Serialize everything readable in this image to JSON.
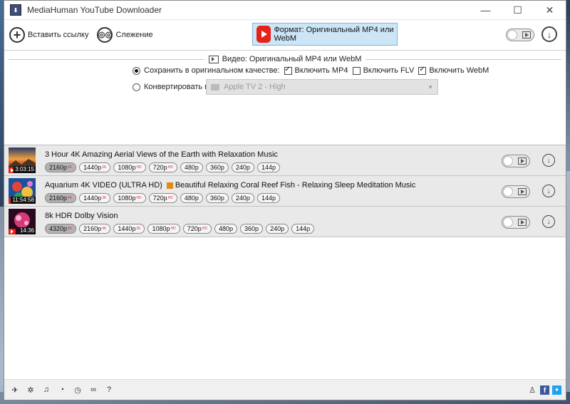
{
  "window": {
    "title": "MediaHuman YouTube Downloader",
    "app_icon": "app-logo-icon",
    "controls": [
      "minimize-icon",
      "maximize-icon",
      "close-icon"
    ]
  },
  "toolbar": {
    "paste_label": "Вставить ссылку",
    "tracking_label": "Слежение",
    "format_label": "Формат: Оригинальный MP4 или WebM"
  },
  "settings": {
    "section_title": "Видео: Оригинальный MP4 или WebM",
    "keep_original_label": "Сохранить в оригинальном качестве:",
    "include_mp4": "Включить MP4",
    "include_flv": "Включить FLV",
    "include_webm": "Включить WebM",
    "convert_label": "Конвертировать в:",
    "convert_target": "Apple TV 2 - High",
    "keep_original_selected": true,
    "mp4_checked": true,
    "flv_checked": false,
    "webm_checked": true
  },
  "videos": [
    {
      "title": "3 Hour 4K Amazing Aerial Views of the Earth with Relaxation Music",
      "duration": "3:03:15",
      "qualities": [
        {
          "label": "2160p",
          "badge": "4K",
          "selected": true
        },
        {
          "label": "1440p",
          "badge": "2K",
          "selected": false
        },
        {
          "label": "1080p",
          "badge": "HD",
          "selected": false
        },
        {
          "label": "720p",
          "badge": "HD",
          "selected": false
        },
        {
          "label": "480p",
          "badge": "",
          "selected": false
        },
        {
          "label": "360p",
          "badge": "",
          "selected": false
        },
        {
          "label": "240p",
          "badge": "",
          "selected": false
        },
        {
          "label": "144p",
          "badge": "",
          "selected": false
        }
      ]
    },
    {
      "title": "Aquarium 4K VIDEO (ULTRA HD)",
      "playlist": "Beautiful Relaxing Coral Reef Fish - Relaxing Sleep Meditation Music",
      "duration": "11:54:58",
      "qualities": [
        {
          "label": "2160p",
          "badge": "4K",
          "selected": true
        },
        {
          "label": "1440p",
          "badge": "2K",
          "selected": false
        },
        {
          "label": "1080p",
          "badge": "HD",
          "selected": false
        },
        {
          "label": "720p",
          "badge": "HD",
          "selected": false
        },
        {
          "label": "480p",
          "badge": "",
          "selected": false
        },
        {
          "label": "360p",
          "badge": "",
          "selected": false
        },
        {
          "label": "240p",
          "badge": "",
          "selected": false
        },
        {
          "label": "144p",
          "badge": "",
          "selected": false
        }
      ]
    },
    {
      "title": "8k HDR Dolby Vision",
      "duration": "14:36",
      "qualities": [
        {
          "label": "4320p",
          "badge": "8K",
          "selected": true
        },
        {
          "label": "2160p",
          "badge": "4K",
          "selected": false
        },
        {
          "label": "1440p",
          "badge": "2K",
          "selected": false
        },
        {
          "label": "1080p",
          "badge": "HD",
          "selected": false
        },
        {
          "label": "720p",
          "badge": "HD",
          "selected": false
        },
        {
          "label": "480p",
          "badge": "",
          "selected": false
        },
        {
          "label": "360p",
          "badge": "",
          "selected": false
        },
        {
          "label": "240p",
          "badge": "",
          "selected": false
        },
        {
          "label": "144p",
          "badge": "",
          "selected": false
        }
      ]
    }
  ],
  "statusbar": {
    "left_icons": [
      "telegram-icon",
      "settings-icon",
      "music-icon",
      "snail-icon",
      "clock-icon",
      "binoculars-icon",
      "help-icon"
    ],
    "help_glyph": "?",
    "right_icons": [
      "users-icon",
      "facebook-icon",
      "twitter-icon"
    ]
  },
  "colors": {
    "format_bg": "#cde6f7",
    "youtube_red": "#e62117",
    "row_bg": "#e9e9e9",
    "quality_badge": "#d33333"
  }
}
